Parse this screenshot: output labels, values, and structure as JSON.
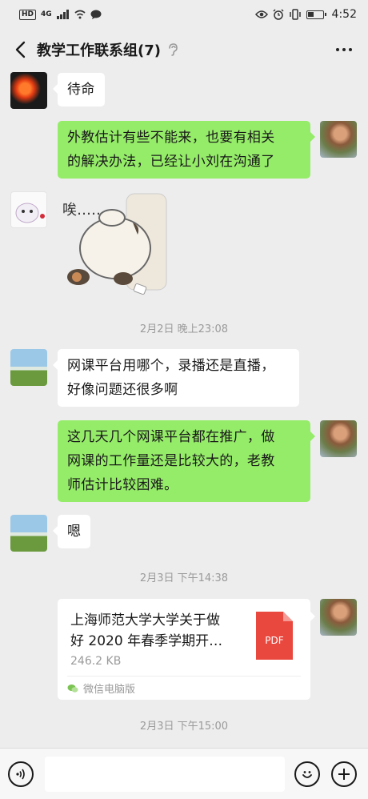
{
  "status_bar": {
    "network": "HD",
    "signal": "4G",
    "time": "4:52"
  },
  "header": {
    "title": "教学工作联系组(7)"
  },
  "messages": [
    {
      "side": "left",
      "text": "待命"
    },
    {
      "side": "right",
      "lines": [
        "外教估计有些不能来，也要有相关",
        "的解决办法，已经让小刘在沟通了"
      ]
    },
    {
      "side": "left",
      "sticker_text": "唉……"
    },
    {
      "timestamp": "2月2日 晚上23:08"
    },
    {
      "side": "left",
      "lines": [
        "网课平台用哪个，录播还是直播，",
        "好像问题还很多啊"
      ]
    },
    {
      "side": "right",
      "lines": [
        "这几天几个网课平台都在推广，做",
        "网课的工作量还是比较大的，老教",
        "师估计比较困难。"
      ]
    },
    {
      "side": "left",
      "text": "嗯"
    },
    {
      "timestamp": "2月3日 下午14:38"
    },
    {
      "side": "right",
      "file": {
        "name_lines": [
          "上海师范大学大学关于做",
          "好 2020 年春季学期开…"
        ],
        "size": "246.2 KB",
        "icon_label": "PDF",
        "source": "微信电脑版"
      }
    },
    {
      "timestamp": "2月3日 下午15:00"
    }
  ],
  "colors": {
    "self_bubble": "#95ec69",
    "other_bubble": "#ffffff",
    "background": "#ededed",
    "pdf": "#e9483f"
  }
}
